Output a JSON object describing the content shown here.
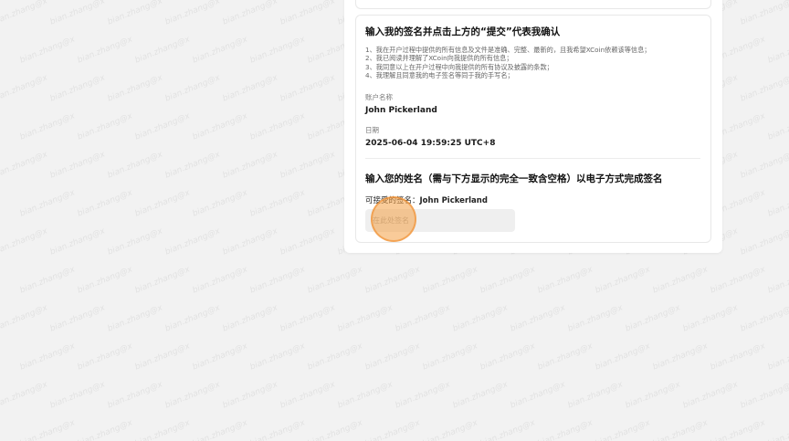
{
  "confirmation": {
    "title": "输入我的签名并点击上方的“提交”代表我确认",
    "terms": [
      "1、我在开户过程中提供的所有信息及文件是准确、完整、最新的，且我希望XCoin依赖该等信息；",
      "2、我已阅读并理解了XCoin向我提供的所有信息；",
      "3、我同意以上在开户过程中向我提供的所有协议及披露的条款；",
      "4、我理解且同意我的电子签名等同于我的手写名；"
    ],
    "account_name_label": "账户名称",
    "account_name_value": "John Pickerland",
    "date_label": "日期",
    "date_value": "2025-06-04 19:59:25 UTC+8"
  },
  "signature": {
    "title": "输入您的姓名（需与下方显示的完全一致含空格）以电子方式完成签名",
    "acceptable_label": "可接受的签名：",
    "acceptable_name": "John Pickerland",
    "input_placeholder": "在此处签名",
    "input_value": ""
  },
  "watermark_text": "bian.zhang@x"
}
